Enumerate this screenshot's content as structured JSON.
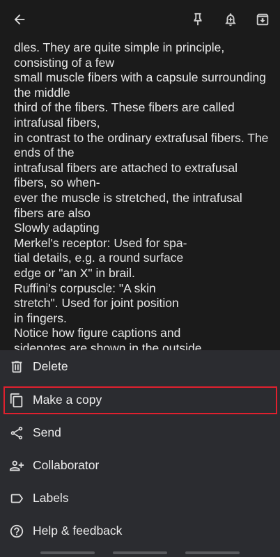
{
  "icons": {
    "back": "arrow-back-icon",
    "pin": "pin-icon",
    "reminder": "reminder-bell-icon",
    "archive": "archive-icon"
  },
  "note": {
    "lines": [
      "dles. They are quite simple in principle,",
      "consisting of a few",
      "small muscle fibers with a capsule surrounding",
      "the middle",
      "third of the fibers. These fibers are called",
      "intrafusal fibers,",
      "in contrast to the ordinary extrafusal fibers. The",
      "ends of the",
      "intrafusal fibers are attached to extrafusal",
      "fibers, so when-",
      "ever the muscle is stretched, the intrafusal",
      "fibers are also",
      "Slowly adapting",
      "Merkel's receptor: Used for spa-",
      "tial details, e.g. a round surface",
      "edge or \"an X\" in brail.",
      "Ruffini's corpuscle: \"A skin",
      "stretch\". Used for joint position",
      "in fingers.",
      "Notice how figure captions and",
      "sidenotes are shown in the outside"
    ]
  },
  "menu": {
    "items": [
      {
        "label": "Delete",
        "icon": "trash-icon"
      },
      {
        "label": "Make a copy",
        "icon": "copy-icon"
      },
      {
        "label": "Send",
        "icon": "share-icon"
      },
      {
        "label": "Collaborator",
        "icon": "person-add-icon"
      },
      {
        "label": "Labels",
        "icon": "label-icon"
      },
      {
        "label": "Help & feedback",
        "icon": "help-icon"
      }
    ]
  },
  "colors": {
    "background": "#1b1b1b",
    "sheet": "#2b2c30",
    "highlight": "#e0202e",
    "text": "#e8e8e8"
  }
}
